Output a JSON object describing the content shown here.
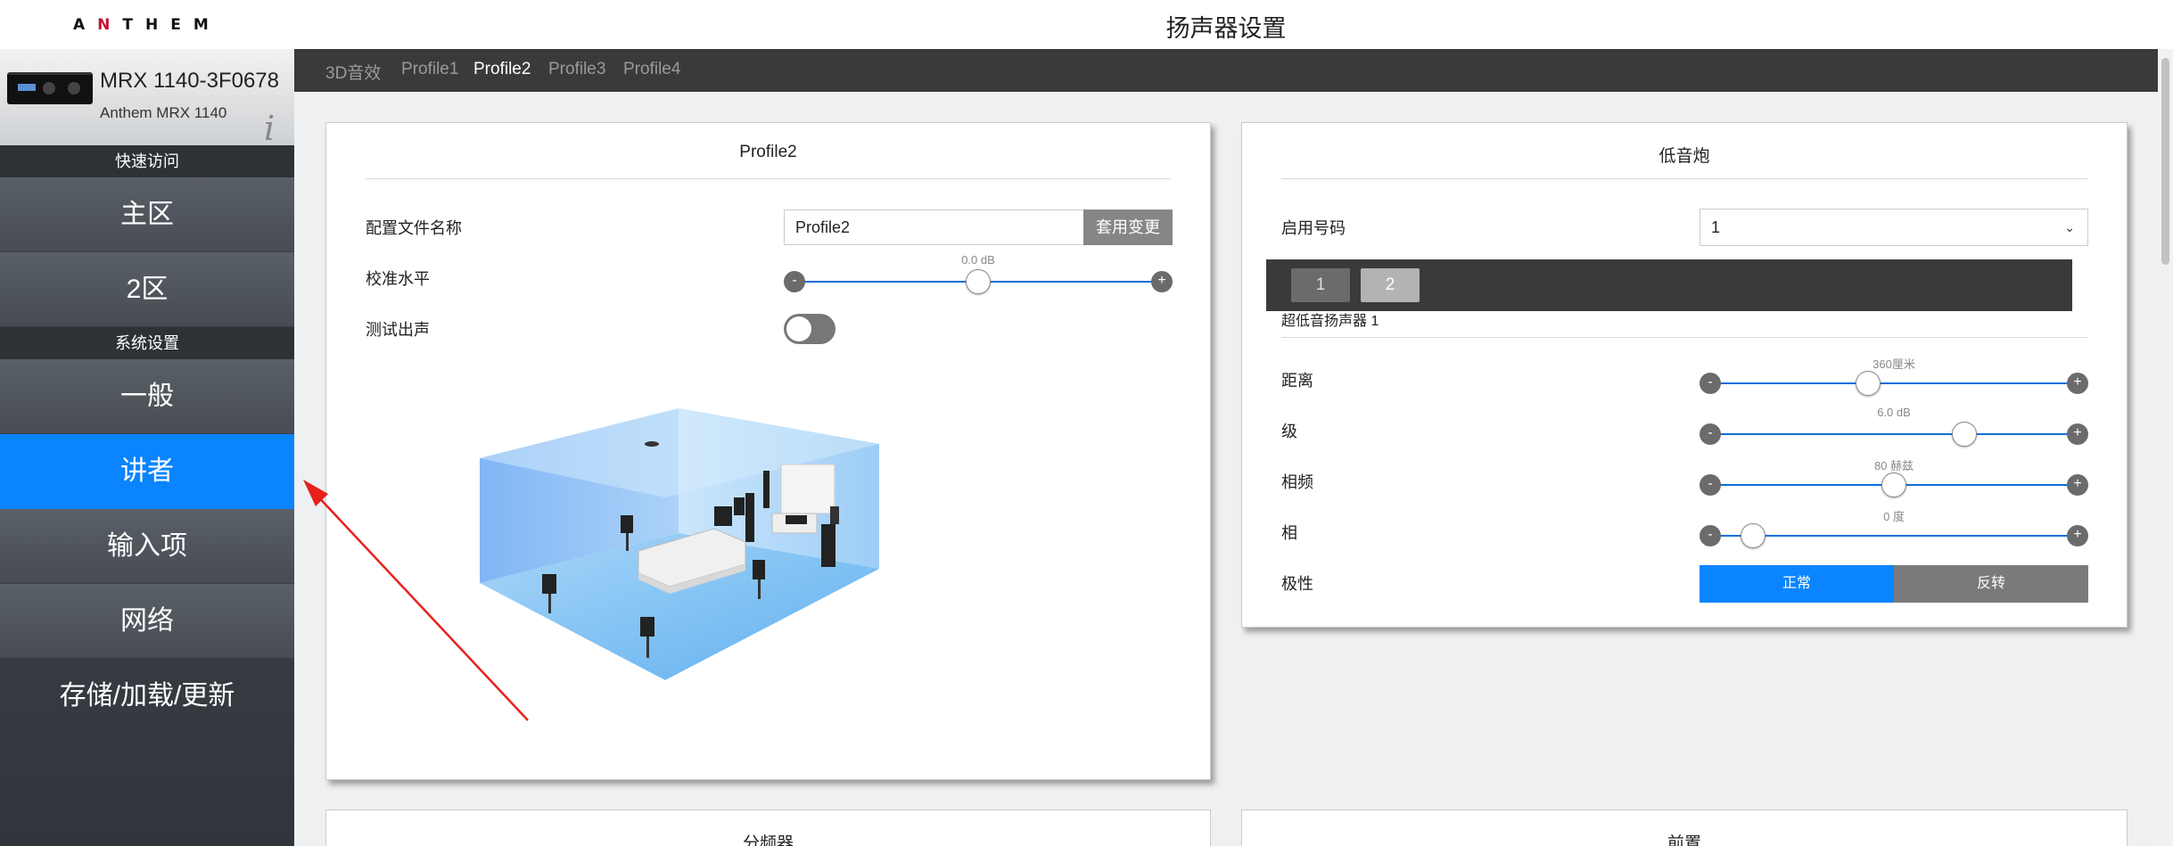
{
  "brand": {
    "logo_text": "ANTHEM"
  },
  "page": {
    "title": "扬声器设置"
  },
  "device": {
    "name": "MRX 1140-3F0678",
    "model": "Anthem MRX 1140",
    "info_glyph": "i"
  },
  "sidebar": {
    "quick_access_header": "快速访问",
    "quick_items": [
      {
        "label": "主区"
      },
      {
        "label": "2区"
      }
    ],
    "system_header": "系统设置",
    "system_items": [
      {
        "label": "一般"
      },
      {
        "label": "讲者",
        "active": true
      },
      {
        "label": "输入项"
      },
      {
        "label": "网络"
      },
      {
        "label": "存储/加载/更新"
      }
    ]
  },
  "tabs": [
    {
      "label": "3D音效"
    },
    {
      "label": "Profile1"
    },
    {
      "label": "Profile2",
      "active": true
    },
    {
      "label": "Profile3"
    },
    {
      "label": "Profile4"
    }
  ],
  "profile_panel": {
    "title": "Profile2",
    "name_label": "配置文件名称",
    "name_value": "Profile2",
    "apply_button": "套用变更",
    "level_label": "校准水平",
    "level_value": "0.0 dB",
    "level_fraction": 0.5,
    "test_label": "测试出声",
    "test_on": false
  },
  "sub_panel": {
    "title": "低音炮",
    "enabled_label": "启用号码",
    "enabled_value": "1",
    "sub_tabs": [
      {
        "label": "1"
      },
      {
        "label": "2",
        "active": true
      }
    ],
    "section_label": "超低音扬声器 1",
    "rows": [
      {
        "label": "距离",
        "value": "360厘米",
        "fraction": 0.42
      },
      {
        "label": "级",
        "value": "6.0 dB",
        "fraction": 0.72
      },
      {
        "label": "相频",
        "value": "80 赫兹",
        "fraction": 0.5
      },
      {
        "label": "相",
        "value": "0 度",
        "fraction": 0.06
      }
    ],
    "polarity_label": "极性",
    "polarity_options": [
      {
        "label": "正常",
        "selected": true
      },
      {
        "label": "反转",
        "selected": false
      }
    ]
  },
  "bottom_panels": {
    "left_title": "分频器",
    "right_title": "前置"
  },
  "slider_buttons": {
    "minus": "-",
    "plus": "+"
  },
  "colors": {
    "accent": "#0a84ff",
    "sidebar": "#3e434a",
    "tabbar": "#3a3a3a",
    "annotation": "#e8201c"
  }
}
